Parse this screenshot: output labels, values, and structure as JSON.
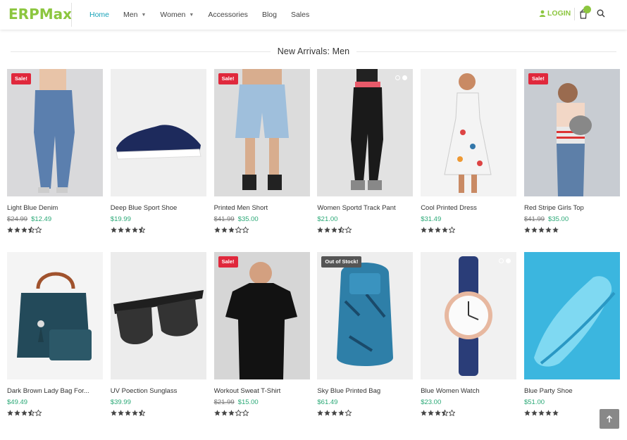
{
  "logo": {
    "text": "ERPMax"
  },
  "nav": {
    "home": "Home",
    "men": "Men",
    "women": "Women",
    "accessories": "Accessories",
    "blog": "Blog",
    "sales": "Sales"
  },
  "header": {
    "login": "LOGIN"
  },
  "section": {
    "title": "New Arrivals: Men"
  },
  "products": [
    {
      "name": "Light Blue Denim",
      "old_price": "$24.99",
      "price": "$12.49",
      "rating": 3.5,
      "badge": "Sale!",
      "bg": "#d9d9db",
      "icon": "jeans"
    },
    {
      "name": "Deep Blue Sport Shoe",
      "old_price": "",
      "price": "$19.99",
      "rating": 4.5,
      "badge": "",
      "bg": "#efefef",
      "icon": "shoe"
    },
    {
      "name": "Printed Men Short",
      "old_price": "$41.99",
      "price": "$35.00",
      "rating": 3,
      "badge": "Sale!",
      "bg": "#dcdcdc",
      "icon": "shorts"
    },
    {
      "name": "Women Sportd Track Pant",
      "old_price": "",
      "price": "$21.00",
      "rating": 3.5,
      "badge": "",
      "bg": "#e2e2e2",
      "icon": "pants",
      "dots": true
    },
    {
      "name": "Cool Printed Dress",
      "old_price": "",
      "price": "$31.49",
      "rating": 4,
      "badge": "",
      "bg": "#f3f3f3",
      "icon": "dress"
    },
    {
      "name": "Red Stripe Girls Top",
      "old_price": "$41.99",
      "price": "$35.00",
      "rating": 5,
      "badge": "Sale!",
      "bg": "#cdd0d4",
      "icon": "top"
    },
    {
      "name": "Dark Brown Lady Bag For...",
      "old_price": "",
      "price": "$49.49",
      "rating": 3.5,
      "badge": "",
      "bg": "#f4f4f4",
      "icon": "bag"
    },
    {
      "name": "UV Poection Sunglass",
      "old_price": "",
      "price": "$39.99",
      "rating": 4.5,
      "badge": "",
      "bg": "#ececec",
      "icon": "sunglass"
    },
    {
      "name": "Workout Sweat T-Shirt",
      "old_price": "$21.99",
      "price": "$15.00",
      "rating": 3,
      "badge": "Sale!",
      "bg": "#d6d6d6",
      "icon": "tshirt"
    },
    {
      "name": "Sky Blue Printed Bag",
      "old_price": "",
      "price": "$61.49",
      "rating": 4,
      "badge": "Out of Stock!",
      "bg": "#eeeeee",
      "icon": "backpack"
    },
    {
      "name": "Blue Women Watch",
      "old_price": "",
      "price": "$23.00",
      "rating": 3.5,
      "badge": "",
      "bg": "#f1f1f1",
      "icon": "watch",
      "dots": true
    },
    {
      "name": "Blue Party Shoe",
      "old_price": "",
      "price": "$51.00",
      "rating": 5,
      "badge": "",
      "bg": "#3bb6df",
      "icon": "blue-shoe"
    }
  ],
  "colors": {
    "accent": "#8cc63f",
    "nav_active": "#17a2b8",
    "price": "#2aa876",
    "sale_badge": "#e0283c",
    "out_badge": "#555555"
  }
}
